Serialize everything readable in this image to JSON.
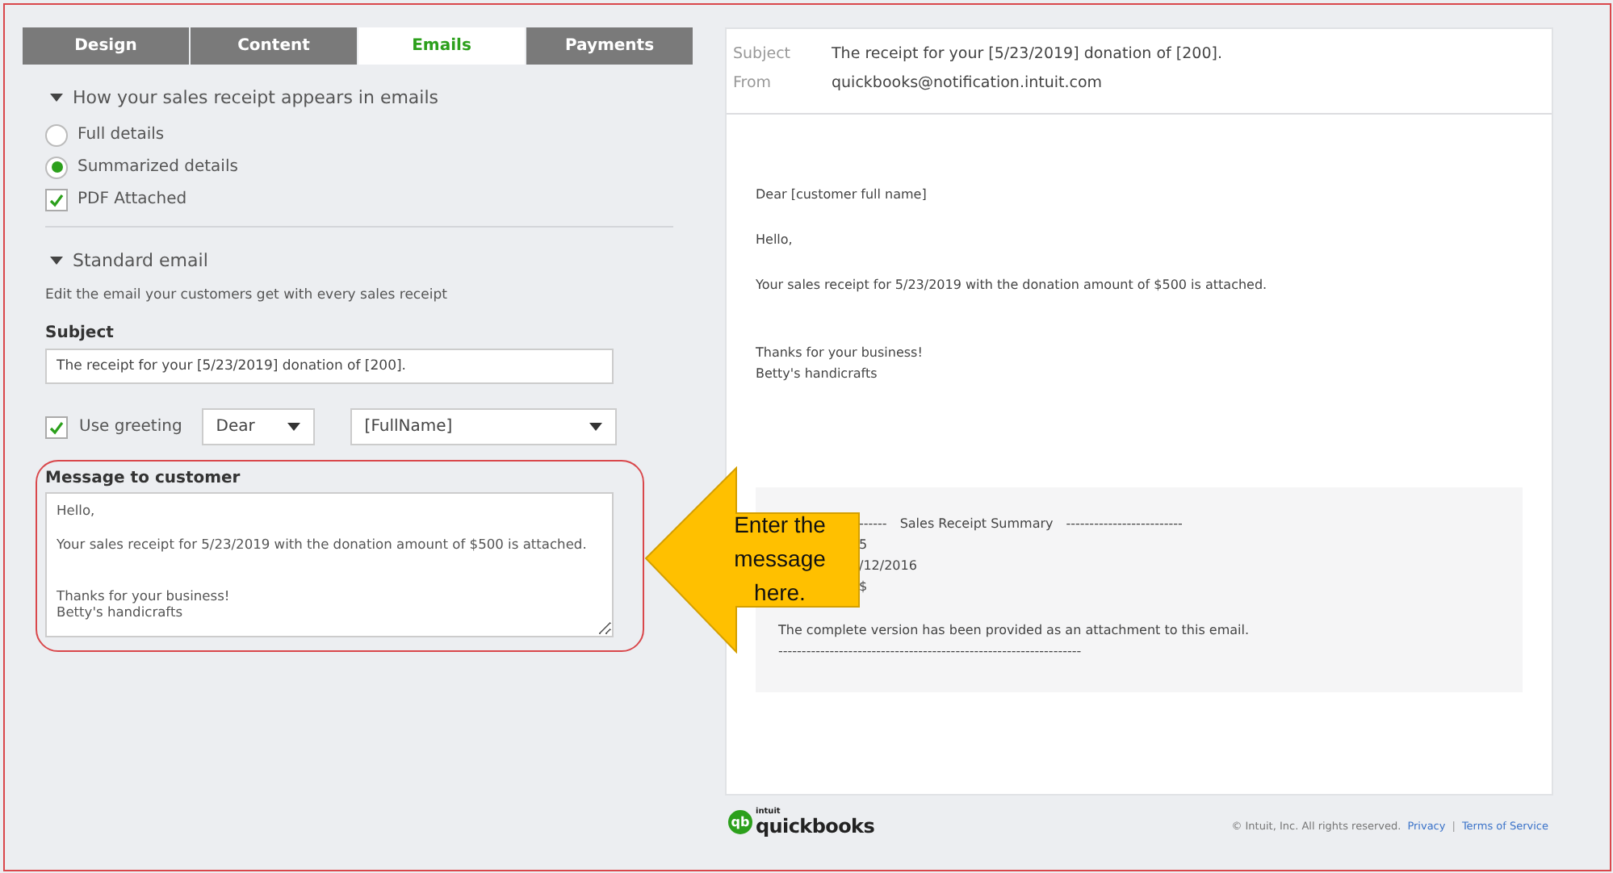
{
  "tabs": [
    {
      "label": "Design",
      "selected": false
    },
    {
      "label": "Content",
      "selected": false
    },
    {
      "label": "Emails",
      "selected": true
    },
    {
      "label": "Payments",
      "selected": false
    }
  ],
  "appearance": {
    "heading": "How your sales receipt appears in emails",
    "expanded": true,
    "options": [
      {
        "kind": "radio",
        "label": "Full details",
        "checked": false
      },
      {
        "kind": "radio",
        "label": "Summarized details",
        "checked": true
      },
      {
        "kind": "checkbox",
        "label": "PDF Attached",
        "checked": true
      }
    ]
  },
  "standard_email": {
    "heading": "Standard email",
    "expanded": true,
    "description": "Edit the email your customers get with every sales receipt",
    "subject_label": "Subject",
    "subject_value": "The receipt for your [5/23/2019] donation of [200].",
    "use_greeting": {
      "label": "Use greeting",
      "checked": true
    },
    "greeting_word": "Dear",
    "greeting_name": "[FullName]",
    "message_label": "Message to customer",
    "message_value": "Hello,\n\nYour sales receipt for 5/23/2019 with the donation amount of $500 is attached.\n\n\nThanks for your business!\nBetty's handicrafts"
  },
  "preview": {
    "subject_label": "Subject",
    "subject": "The receipt for your [5/23/2019] donation of [200].",
    "from_label": "From",
    "from": "quickbooks@notification.intuit.com",
    "paragraphs": [
      [
        "Dear [customer full name]"
      ],
      [
        "Hello,"
      ],
      [
        "Your sales receipt for 5/23/2019 with the donation amount of $500 is attached."
      ],
      [
        "Thanks for your business!",
        "Betty's handicrafts"
      ]
    ],
    "summary": {
      "heading": [
        "------",
        "Sales Receipt Summary",
        "-------------------------"
      ],
      "lines": [
        "5",
        "/12/2016",
        "$"
      ],
      "note": "The complete version has been provided as an attachment to this email.",
      "rule": "-----------------------------------------------------------------"
    }
  },
  "footer": {
    "logo_mark": "qb",
    "logo_small": "intuit",
    "logo_name": "quickbooks",
    "copyright": "© Intuit, Inc. All rights reserved.",
    "links": [
      "Privacy",
      "Terms of Service"
    ],
    "separator": "|"
  },
  "callout": {
    "text": "Enter the message here."
  }
}
